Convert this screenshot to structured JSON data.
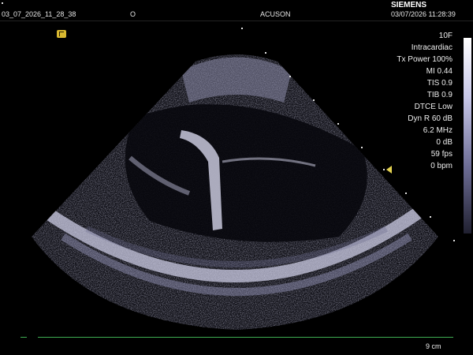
{
  "header": {
    "patient_id": "03_07_2026_11_28_38",
    "center_mark": "O",
    "brand_sub": "ACUSON",
    "brand_main": "SIEMENS",
    "timestamp": "03/07/2026 11:28:39"
  },
  "params": {
    "transducer": "10F",
    "preset": "Intracardiac",
    "tx_power": "Tx Power 100%",
    "mi": "MI 0.44",
    "tis": "TIS 0.9",
    "tib": "TIB 0.9",
    "dtce": "DTCE Low",
    "dyn_range": "Dyn R 60 dB",
    "frequency": "6.2 MHz",
    "gain": "0 dB",
    "frame_rate": "59 fps",
    "heart_rate": "0 bpm"
  },
  "footer": {
    "depth": "9 cm"
  },
  "colors": {
    "scale_line": "#3fae52",
    "focus_marker": "#e4d250",
    "orientation_marker": "#d8b830"
  },
  "icons": {
    "orientation": "orientation-marker-icon",
    "focus": "focus-triangle-icon"
  }
}
